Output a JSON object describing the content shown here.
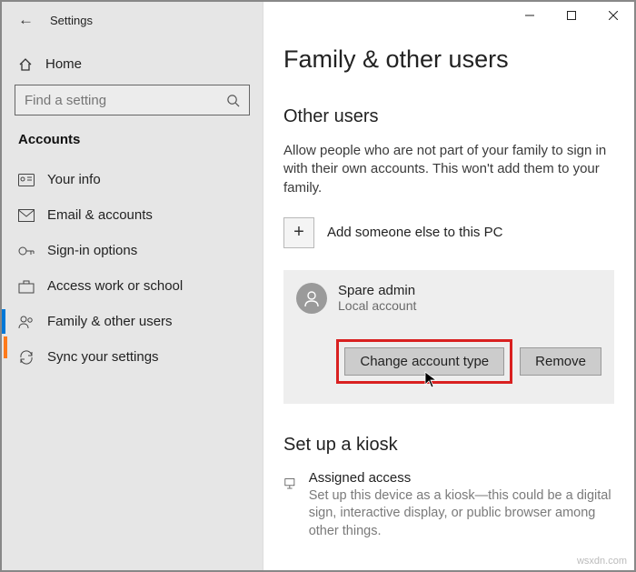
{
  "titlebar": {
    "title": "Settings"
  },
  "sidebar": {
    "home": "Home",
    "search_placeholder": "Find a setting",
    "category": "Accounts",
    "items": [
      {
        "label": "Your info"
      },
      {
        "label": "Email & accounts"
      },
      {
        "label": "Sign-in options"
      },
      {
        "label": "Access work or school"
      },
      {
        "label": "Family & other users"
      },
      {
        "label": "Sync your settings"
      }
    ]
  },
  "main": {
    "title": "Family & other users",
    "other_users_h": "Other users",
    "other_users_p": "Allow people who are not part of your family to sign in with their own accounts. This won't add them to your family.",
    "add_label": "Add someone else to this PC",
    "user": {
      "name": "Spare admin",
      "type": "Local account"
    },
    "btn_change": "Change account type",
    "btn_remove": "Remove",
    "kiosk_h": "Set up a kiosk",
    "assigned_title": "Assigned access",
    "assigned_desc": "Set up this device as a kiosk—this could be a digital sign, interactive display, or public browser among other things."
  },
  "watermark": "wsxdn.com"
}
